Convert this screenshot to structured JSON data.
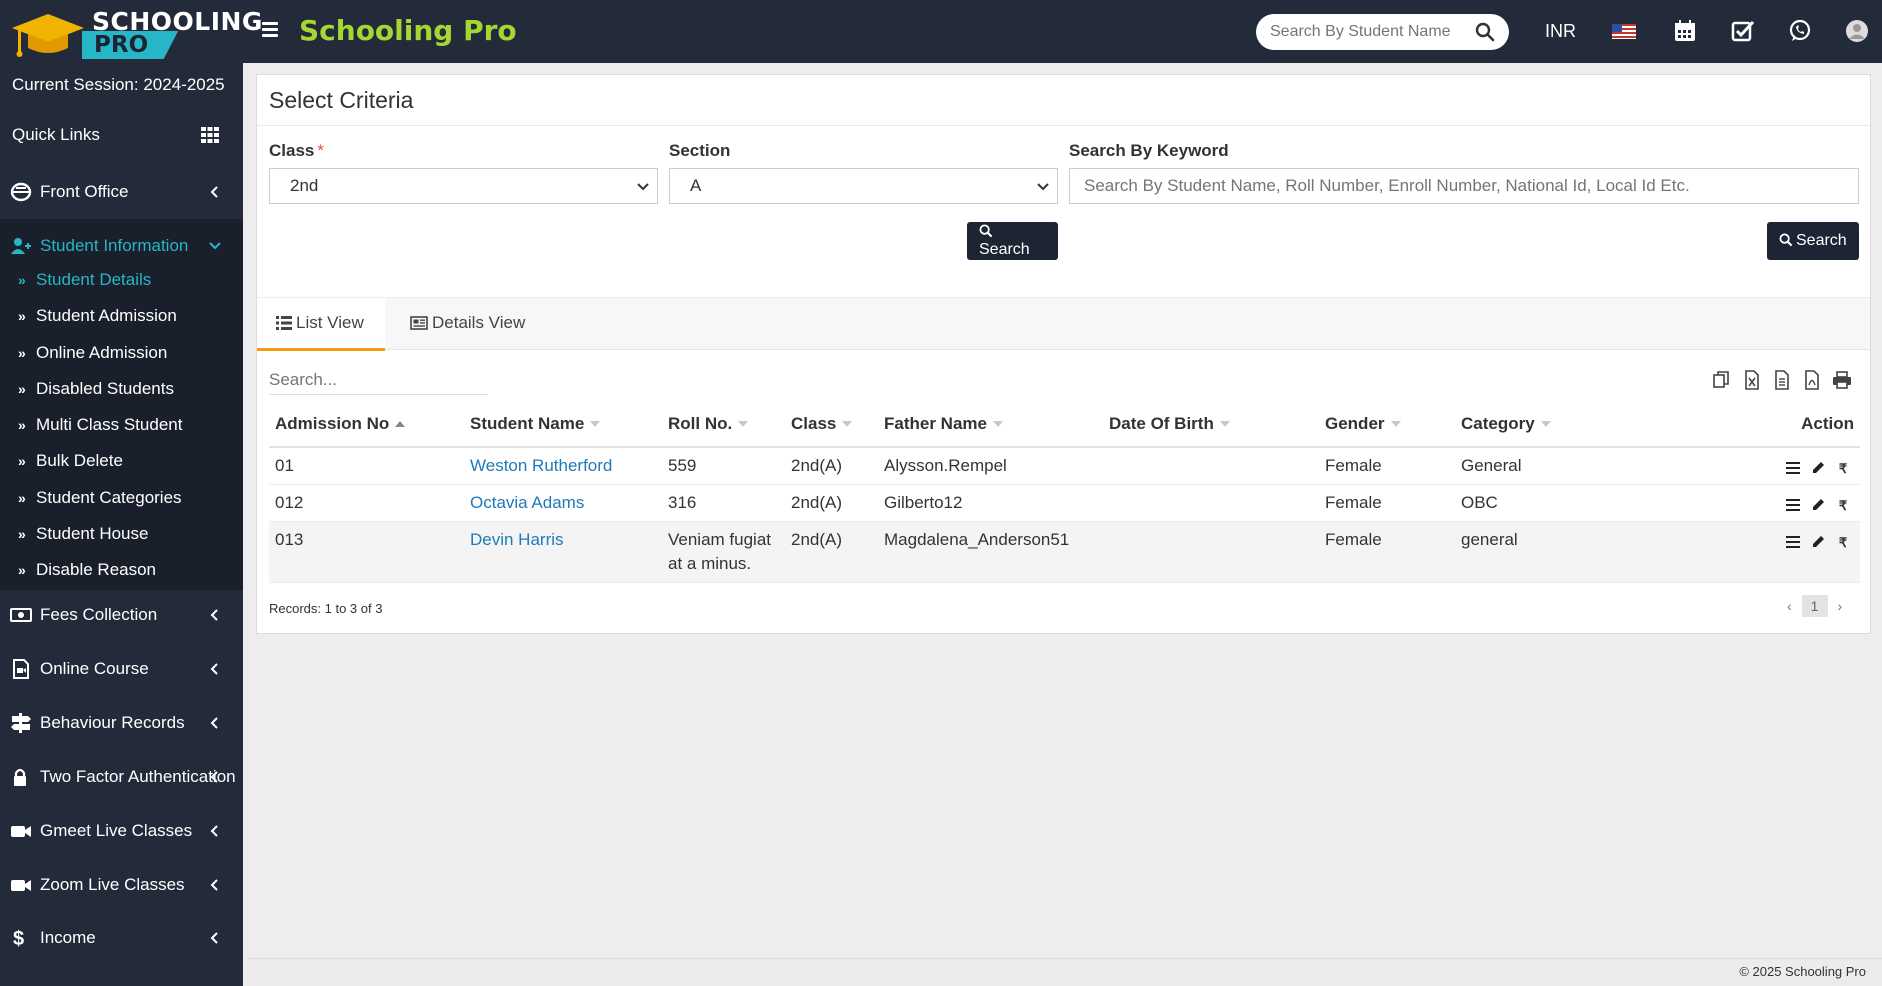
{
  "header": {
    "logo_line1": "SCHOOLING",
    "logo_line2": "PRO",
    "brand": "Schooling Pro",
    "search_placeholder": "Search By Student Name",
    "currency": "INR"
  },
  "sidebar": {
    "session": "Current Session: 2024-2025",
    "quick_links": "Quick Links",
    "items": [
      {
        "label": "Front Office"
      },
      {
        "label": "Student Information"
      },
      {
        "label": "Fees Collection"
      },
      {
        "label": "Online Course"
      },
      {
        "label": "Behaviour Records"
      },
      {
        "label": "Two Factor Authentication"
      },
      {
        "label": "Gmeet Live Classes"
      },
      {
        "label": "Zoom Live Classes"
      },
      {
        "label": "Income"
      }
    ],
    "submenu": [
      {
        "label": "Student Details"
      },
      {
        "label": "Student Admission"
      },
      {
        "label": "Online Admission"
      },
      {
        "label": "Disabled Students"
      },
      {
        "label": "Multi Class Student"
      },
      {
        "label": "Bulk Delete"
      },
      {
        "label": "Student Categories"
      },
      {
        "label": "Student House"
      },
      {
        "label": "Disable Reason"
      }
    ]
  },
  "criteria": {
    "title": "Select Criteria",
    "class_label": "Class",
    "class_value": "2nd",
    "section_label": "Section",
    "section_value": "A",
    "keyword_label": "Search By Keyword",
    "keyword_placeholder": "Search By Student Name, Roll Number, Enroll Number, National Id, Local Id Etc.",
    "search_btn": "Search",
    "search_btn2": "Search"
  },
  "tabs": {
    "list_view": "List View",
    "details_view": "Details View"
  },
  "table": {
    "search_placeholder": "Search...",
    "headers": {
      "admission_no": "Admission No",
      "student_name": "Student Name",
      "roll_no": "Roll No.",
      "class": "Class",
      "father_name": "Father Name",
      "dob": "Date Of Birth",
      "gender": "Gender",
      "category": "Category",
      "action": "Action"
    },
    "rows": [
      {
        "admission_no": "01",
        "student_name": "Weston Rutherford",
        "roll_no": "559",
        "class": "2nd(A)",
        "father_name": "Alysson.Rempel",
        "dob": "",
        "gender": "Female",
        "category": "General"
      },
      {
        "admission_no": "012",
        "student_name": "Octavia Adams",
        "roll_no": "316",
        "class": "2nd(A)",
        "father_name": "Gilberto12",
        "dob": "",
        "gender": "Female",
        "category": "OBC"
      },
      {
        "admission_no": "013",
        "student_name": "Devin Harris",
        "roll_no": "Veniam fugiat at a minus.",
        "class": "2nd(A)",
        "father_name": "Magdalena_Anderson51",
        "dob": "",
        "gender": "Female",
        "category": "general"
      }
    ],
    "records_text": "Records: 1 to 3 of 3",
    "current_page": "1",
    "prev": "‹",
    "next": "›"
  },
  "footer": {
    "text": "© 2025 Schooling Pro"
  },
  "colors": {
    "sidebar_bg": "#232b3a",
    "brand_green": "#a5d633",
    "accent_teal": "#27b5c8",
    "tab_accent": "#f39c12",
    "link_blue": "#1f7ab8"
  }
}
